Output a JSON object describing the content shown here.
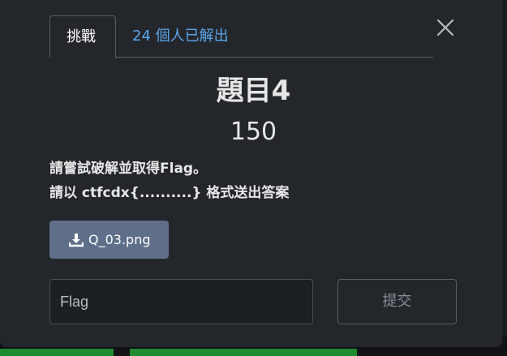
{
  "tabs": {
    "challenge_label": "挑戰",
    "solves_label": "24 個人已解出"
  },
  "challenge": {
    "title": "題目4",
    "points": "150",
    "description_line1": "請嘗試破解並取得Flag。",
    "description_line2": "請以 ctfcdx{..........} 格式送出答案"
  },
  "file": {
    "label": "Q_03.png",
    "icon": "download-icon"
  },
  "flag_input": {
    "value": "",
    "placeholder": "Flag"
  },
  "submit": {
    "label": "提交"
  },
  "colors": {
    "modal_bg": "#23262b",
    "accent_link": "#5aa7ef",
    "file_button_bg": "#5f6f8a"
  }
}
